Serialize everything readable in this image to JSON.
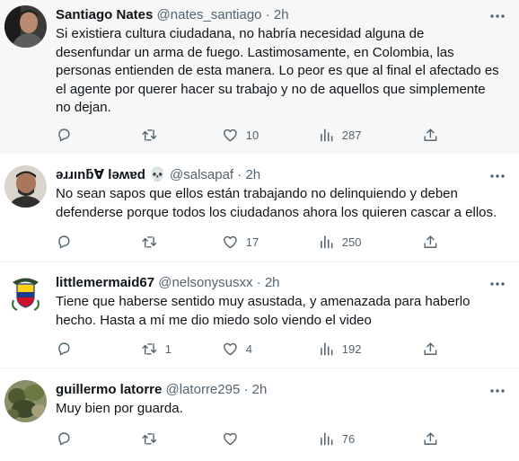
{
  "tweets": [
    {
      "name": "Santiago Nates",
      "handle": "@nates_santiago",
      "dot": "·",
      "time": "2h",
      "lines": [
        "Si existiera cultura ciudadana, no habría necesidad alguna de",
        "desenfundar un arma de fuego. Lastimosamente, en Colombia, las",
        "personas entienden de esta manera. Lo peor es que al final el afectado es",
        "el agente por querer hacer su trabajo y no de aquellos que simplemente",
        "no dejan."
      ],
      "replies": "",
      "retweets": "",
      "likes": "10",
      "views": "287"
    },
    {
      "name": "ǝɹɹınƃ∀ lǝʍɐd",
      "emoji": "💀",
      "handle": "@salsapaf",
      "dot": "·",
      "time": "2h",
      "lines": [
        "No sean sapos que ellos están trabajando no delinquiendo y deben",
        "defenderse porque todos los ciudadanos ahora los quieren cascar a ellos."
      ],
      "replies": "",
      "retweets": "",
      "likes": "17",
      "views": "250"
    },
    {
      "name": "littlemermaid67",
      "handle": "@nelsonysusxx",
      "dot": "·",
      "time": "2h",
      "lines": [
        "Tiene que haberse sentido muy asustada, y amenazada para haberlo",
        "hecho. Hasta a mí me dio miedo solo viendo el video"
      ],
      "replies": "",
      "retweets": "1",
      "likes": "4",
      "views": "192"
    },
    {
      "name": "guillermo latorre",
      "handle": "@latorre295",
      "dot": "·",
      "time": "2h",
      "lines": [
        "Muy bien por guarda."
      ],
      "replies": "",
      "retweets": "",
      "likes": "",
      "views": "76"
    }
  ]
}
